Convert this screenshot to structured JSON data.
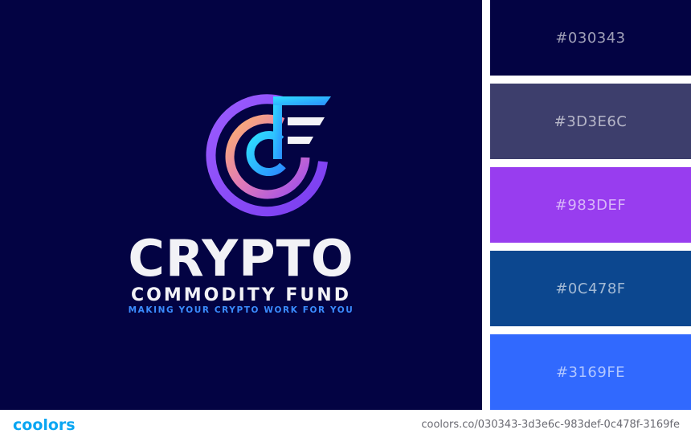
{
  "brand": {
    "title": "CRYPTO",
    "subtitle": "COMMODITY FUND",
    "tagline": "MAKING YOUR CRYPTO WORK FOR YOU"
  },
  "palette": [
    {
      "label": "#030343",
      "color": "#030343"
    },
    {
      "label": "#3D3E6C",
      "color": "#3D3E6C"
    },
    {
      "label": "#983DEF",
      "color": "#983DEF"
    },
    {
      "label": "#0C478F",
      "color": "#0C478F"
    },
    {
      "label": "#3169FE",
      "color": "#3169FE"
    }
  ],
  "footer": {
    "logo": "coolors",
    "url": "coolors.co/030343-3d3e6c-983def-0c478f-3169fe"
  }
}
